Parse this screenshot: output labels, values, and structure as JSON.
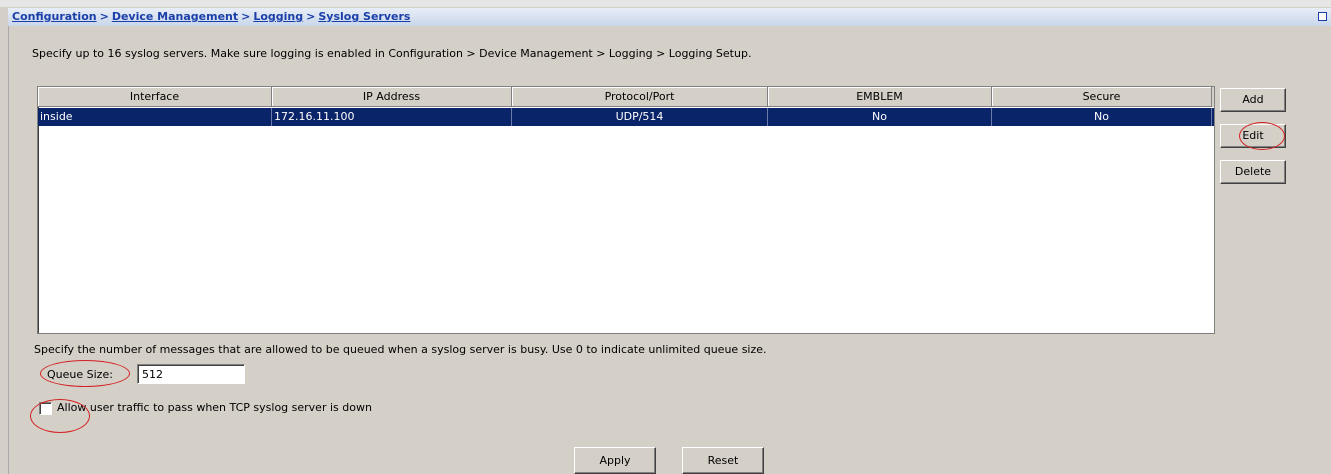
{
  "breadcrumb": {
    "items": [
      "Configuration",
      "Device Management",
      "Logging",
      "Syslog Servers"
    ],
    "separator": ">"
  },
  "description": "Specify up to 16 syslog servers. Make sure logging is enabled in Configuration > Device Management > Logging > Logging Setup.",
  "table": {
    "columns": [
      "Interface",
      "IP Address",
      "Protocol/Port",
      "EMBLEM",
      "Secure"
    ],
    "rows": [
      {
        "interface": "inside",
        "ip_address": "172.16.11.100",
        "protocol_port": "UDP/514",
        "emblem": "No",
        "secure": "No",
        "selected": true
      }
    ]
  },
  "buttons": {
    "add": "Add",
    "edit": "Edit",
    "delete": "Delete",
    "apply": "Apply",
    "reset": "Reset"
  },
  "queue": {
    "description": "Specify the number of messages that are allowed to be queued when a syslog server is busy. Use 0 to indicate unlimited queue size.",
    "label": "Queue Size:",
    "value": "512"
  },
  "allow_traffic": {
    "label": "Allow user traffic to pass when TCP syslog server is down",
    "checked": false
  },
  "colors": {
    "selection": "#0a246a",
    "link": "#1b3fa8",
    "annotation": "#d32020",
    "panel": "#d4d0c8"
  }
}
